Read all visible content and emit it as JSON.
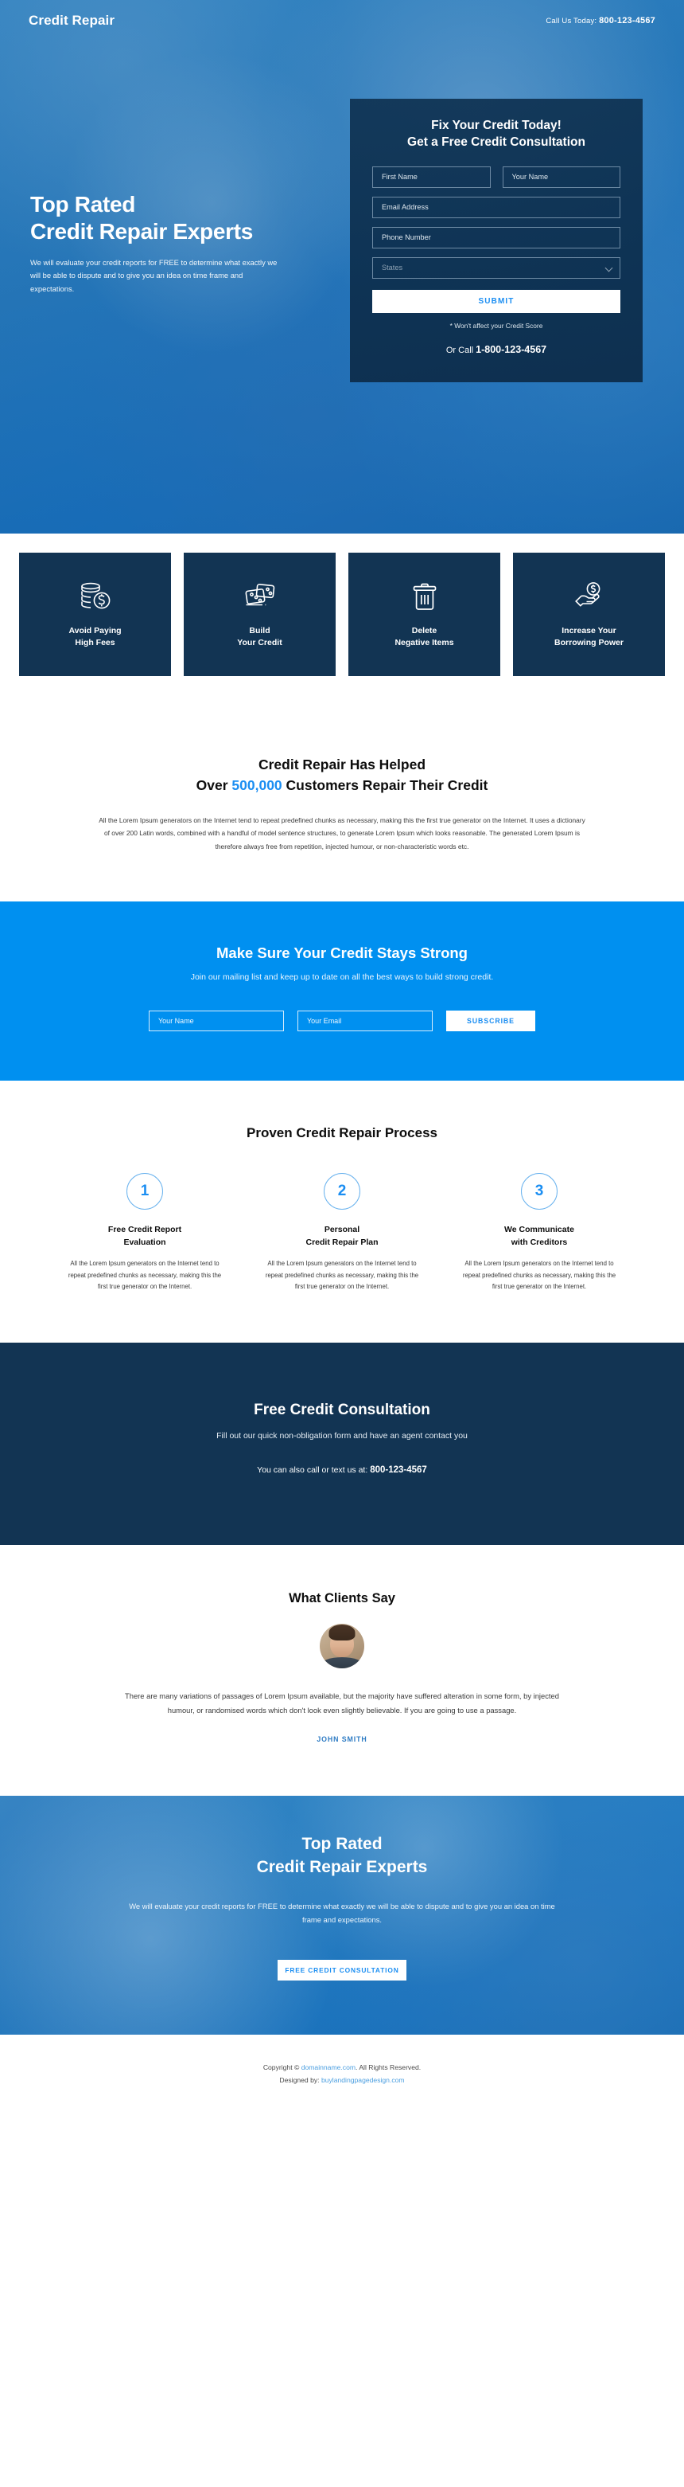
{
  "hero": {
    "logo": "Credit Repair",
    "call_label": "Call Us Today:",
    "call_number": "800-123-4567",
    "headline_line1": "Top Rated",
    "headline_line2": "Credit Repair Experts",
    "subtext": "We will evaluate your credit reports for FREE to determine what exactly we will be able to dispute and to give you an idea on time frame and expectations."
  },
  "hero_form": {
    "title_line1": "Fix Your Credit Today!",
    "title_line2": "Get a Free Credit Consultation",
    "first_name_placeholder": "First Name",
    "last_name_placeholder": "Your Name",
    "email_placeholder": "Email Address",
    "phone_placeholder": "Phone Number",
    "states_placeholder": "States",
    "submit_label": "SUBMIT",
    "note": "* Won't affect your Credit Score",
    "or_call_label": "Or Call",
    "or_call_number": "1-800-123-4567"
  },
  "features": [
    {
      "icon": "coins-dollar-icon",
      "line1": "Avoid Paying",
      "line2": "High Fees"
    },
    {
      "icon": "credit-cards-icon",
      "line1": "Build",
      "line2": "Your Credit"
    },
    {
      "icon": "trash-bin-icon",
      "line1": "Delete",
      "line2": "Negative Items"
    },
    {
      "icon": "hand-holding-dollar-icon",
      "line1": "Increase Your",
      "line2": "Borrowing Power"
    }
  ],
  "helped": {
    "title_line1": "Credit Repair Has Helped",
    "title_pre": "Over ",
    "title_highlight": "500,000",
    "title_post": " Customers Repair Their Credit",
    "body": "All the Lorem Ipsum generators on the Internet tend to repeat predefined chunks as necessary, making this the first true generator on the Internet. It uses a dictionary of over 200 Latin words, combined with a handful of model sentence structures, to generate Lorem Ipsum which looks reasonable. The generated Lorem Ipsum is therefore always free from repetition, injected humour, or non-characteristic words etc."
  },
  "newsletter": {
    "title": "Make Sure Your Credit Stays Strong",
    "subtitle": "Join our mailing list and keep up to date on all the best ways to build strong credit.",
    "name_placeholder": "Your Name",
    "email_placeholder": "Your Email",
    "button_label": "SUBSCRIBE"
  },
  "process": {
    "title": "Proven Credit Repair Process",
    "steps": [
      {
        "number": "1",
        "title_line1": "Free Credit Report",
        "title_line2": "Evaluation",
        "text": "All the Lorem Ipsum generators on the Internet tend to repeat predefined chunks as necessary, making this the first true generator on the Internet."
      },
      {
        "number": "2",
        "title_line1": "Personal",
        "title_line2": "Credit Repair Plan",
        "text": "All the Lorem Ipsum generators on the Internet tend to repeat predefined chunks as necessary, making this the first true generator on the Internet."
      },
      {
        "number": "3",
        "title_line1": "We Communicate",
        "title_line2": "with Creditors",
        "text": "All the Lorem Ipsum generators on the Internet tend to repeat predefined chunks as necessary, making this the first true generator on the Internet."
      }
    ]
  },
  "dark_cta": {
    "title": "Free Credit Consultation",
    "subtitle": "Fill out our quick non-obligation form and have an agent contact you",
    "call_label": "You can also call or text us at:",
    "call_number": "800-123-4567"
  },
  "testimonial": {
    "title": "What Clients Say",
    "avatar": "client-avatar",
    "quote": "There are many variations of passages of Lorem Ipsum available, but the majority have suffered alteration in some form, by injected humour, or randomised words which don't look even slightly believable. If you are going to use a passage.",
    "author": "JOHN SMITH"
  },
  "bottom_cta": {
    "headline_line1": "Top Rated",
    "headline_line2": "Credit Repair Experts",
    "subtext": "We will evaluate your credit reports for FREE to determine what exactly we will be able to dispute and to give you an idea on time frame and expectations.",
    "button_label": "FREE CREDIT CONSULTATION"
  },
  "footer": {
    "copyright_pre": "Copyright © ",
    "copyright_link": "domainname.com",
    "copyright_post": ". All Rights Reserved.",
    "designed_pre": "Designed by: ",
    "designed_link": "buylandingpagedesign.com"
  },
  "colors": {
    "brand_blue": "#0090f0",
    "dark_navy": "#123453",
    "accent_link": "#4c9fe0",
    "hero_blue": "#2b7fc0"
  }
}
